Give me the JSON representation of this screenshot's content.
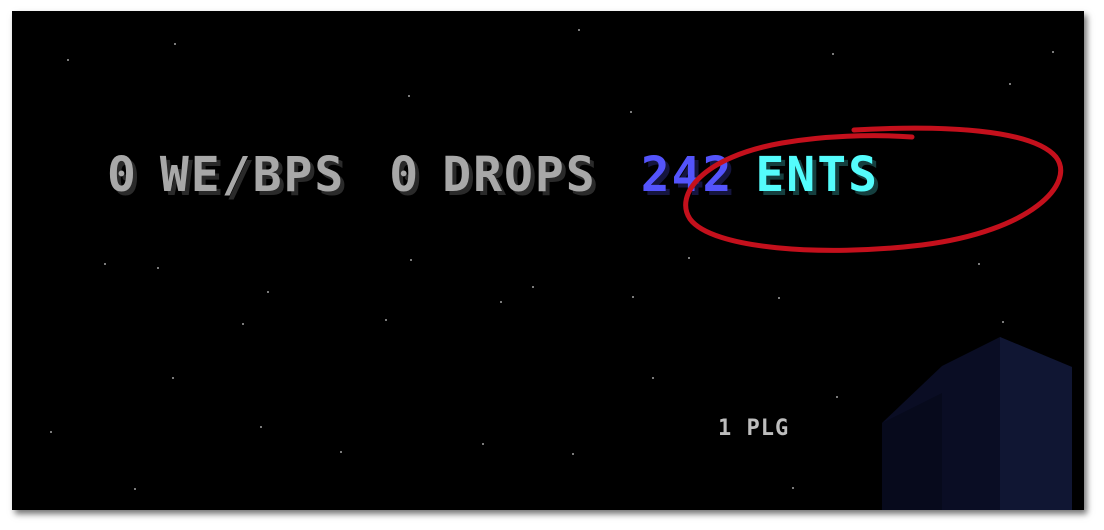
{
  "hud": {
    "we_bps_value": "0",
    "we_bps_label": "WE/BPS",
    "drops_value": "0",
    "drops_label": "DROPS",
    "ents_value": "242",
    "ents_label": "ENTS"
  },
  "footer": {
    "plg_text": "1 PLG"
  },
  "colors": {
    "sky": "#000000",
    "hud_gray": "#a8a8a8",
    "ents_value": "#5454fc",
    "ents_label": "#54fcfc",
    "annotation_circle": "#c4101c"
  },
  "annotations": {
    "circle_target": "ents"
  }
}
